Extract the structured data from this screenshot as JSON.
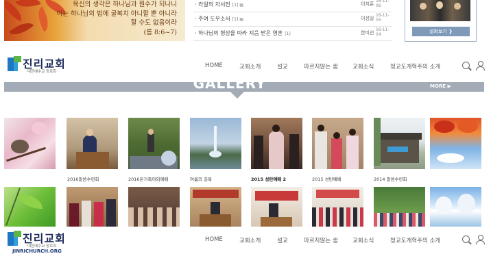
{
  "banner": {
    "verse_lines": [
      "육신의 생각은 하나님과 원수가 되나니",
      "이는 하나님의 법에 굴복치 아니할 뿐 아니라",
      "할 수도 없음이라",
      "(롬 8:6~7)"
    ]
  },
  "news": [
    {
      "title": "라일의 자서전",
      "mark": "[1] ▤",
      "author": "이치훈",
      "date": "16-11-06"
    },
    {
      "title": "주여 도우소서",
      "mark": "[1] ▤",
      "author": "이성일",
      "date": "16-11-05"
    },
    {
      "title": "하나님의 형상을 따라 지음 받은 영혼",
      "mark": "[1]",
      "author": "한미선",
      "date": "16-11-04"
    }
  ],
  "portrait_box": {
    "button": "살펴보기 ❯"
  },
  "header": {
    "logo_name": "진리교회",
    "logo_sub": "대한예수교 장로회",
    "logo_url": "JINRICHURCH.ORG",
    "nav": [
      "HOME",
      "교회소개",
      "설교",
      "마르지않는 샘",
      "교회소식",
      "청교도개혁주의 소개"
    ]
  },
  "gallery": {
    "title": "GALLERY",
    "more": "MORE ▶",
    "row1": [
      {
        "caption": "",
        "bold": false
      },
      {
        "caption": "2016말씀수련회",
        "bold": false
      },
      {
        "caption": "2016온가족야외예배",
        "bold": false
      },
      {
        "caption": "여름의 길목",
        "bold": false
      },
      {
        "caption": "2015 성탄예배 2",
        "bold": true
      },
      {
        "caption": "2015 성탄예배",
        "bold": false
      },
      {
        "caption": "2014 말씀수련회",
        "bold": false
      },
      {
        "caption": "",
        "bold": false
      }
    ]
  },
  "colors": {
    "accent": "#a3abb6",
    "logo_blue": "#1f76c2",
    "logo_green": "#5fb446"
  }
}
